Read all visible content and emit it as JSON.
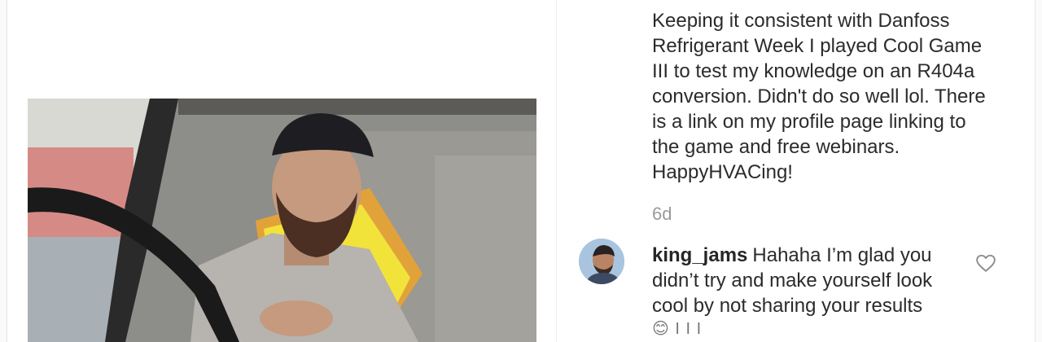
{
  "post": {
    "caption": "Keeping it consistent with Danfoss\nRefrigerant Week I played Cool Game\nIII to test my knowledge on an R404a\nconversion. Didn't do so well lol. There\nis a link on my profile page linking to\nthe game and free webinars.\nHappyHVACing!",
    "timestamp": "6d"
  },
  "comment": {
    "username": "king_jams",
    "text": "Hahaha I’m glad you didn’t try and make yourself look cool by not sharing your results",
    "emoji_line": "😊 I I I"
  },
  "icons": {
    "like": "heart-icon",
    "avatar": "user-avatar"
  },
  "colors": {
    "text": "#262626",
    "muted": "#9a9a9a",
    "vest": "#f2e33a"
  }
}
